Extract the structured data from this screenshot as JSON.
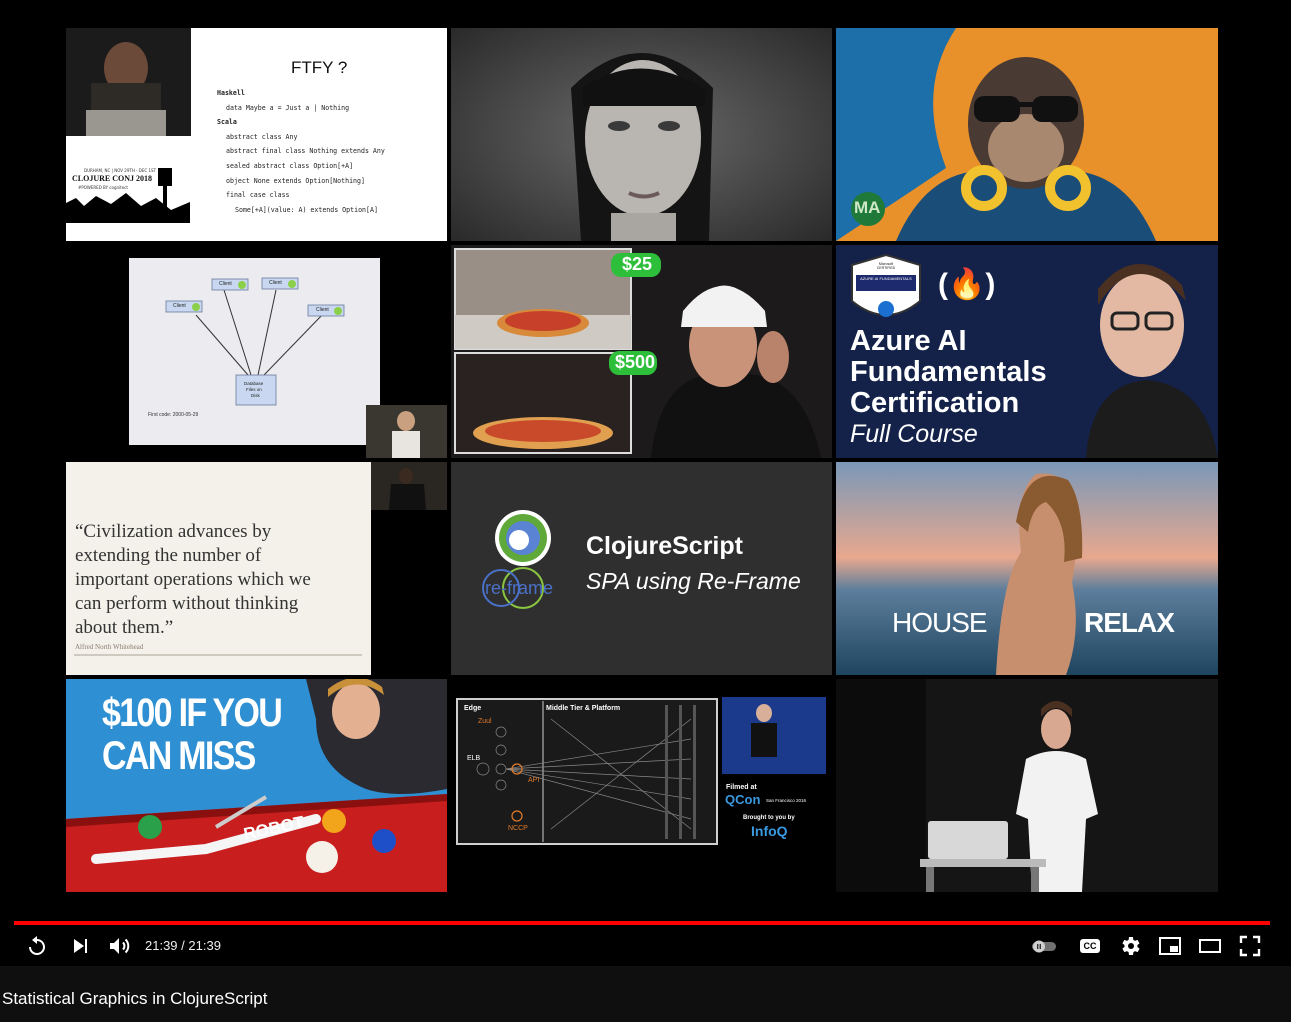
{
  "video": {
    "title": "Statistical Graphics in ClojureScript",
    "time_current": "21:39",
    "time_separator": "/",
    "time_total": "21:39",
    "progress": 1.0,
    "accent": "#ff0000"
  },
  "controls": {
    "replay": "replay-icon",
    "next": "next-icon",
    "volume": "volume-icon",
    "autoplay": "autoplay-toggle-icon",
    "captions": "CC",
    "settings": "gear-icon",
    "miniplayer": "miniplayer-icon",
    "theater": "theater-icon",
    "fullscreen": "fullscreen-icon"
  },
  "end_screen": {
    "t1": {
      "slide_title": "FTFY ?",
      "conf_name": "CLOJURE CONJ 2018",
      "conf_sub": "DURHAM, NC | NOV 29TH - DEC 1ST",
      "powered": "#POWERED BY cognitect",
      "code": [
        "Haskell",
        "data Maybe a = Just a | Nothing",
        "Scala",
        "abstract class Any",
        "abstract final class Nothing extends Any",
        "sealed abstract class Option[+A]",
        "object None extends Option[Nothing]",
        "final case class",
        "Some[+A](value: A) extends Option[A]"
      ]
    },
    "t3": {
      "badge": "MA"
    },
    "t4": {
      "clients": [
        "Client",
        "Client",
        "Client",
        "Client"
      ],
      "db": [
        "Database",
        "Files on",
        "Disk"
      ],
      "footer": "First code: 2000-05-29"
    },
    "t5": {
      "price_a": "$25",
      "price_b": "$500"
    },
    "t6": {
      "badge_top": "Microsoft CERTIFIED",
      "badge_mid": "AZURE AI FUNDAMENTALS",
      "fcc": "(🔥)",
      "line1": "Azure AI",
      "line2": "Fundamentals",
      "line3": "Certification",
      "line4": "Full Course"
    },
    "t7": {
      "quote": [
        "“Civilization advances by",
        "extending the number of",
        "important operations which we",
        "can perform without thinking",
        "about them.”"
      ],
      "author": "Alfred North Whitehead"
    },
    "t8": {
      "title": "ClojureScript",
      "subtitle": "SPA using Re-Frame",
      "logo_word": "re-frame"
    },
    "t9": {
      "left": "HOUSE",
      "right": "RELAX"
    },
    "t10": {
      "line1": "$100 IF YOU",
      "line2": "CAN MISS",
      "robot": "ROBOT"
    },
    "t11": {
      "edge": "Edge",
      "zuul": "Zuul",
      "elb": "ELB",
      "api": "API",
      "nccp": "NCCP",
      "middle": "Middle Tier & Platform",
      "filmed": "Filmed at",
      "qcon": "QCon",
      "qcon_city": "San Francisco 2016",
      "brought": "Brought to you by",
      "infoq": "InfoQ"
    }
  }
}
